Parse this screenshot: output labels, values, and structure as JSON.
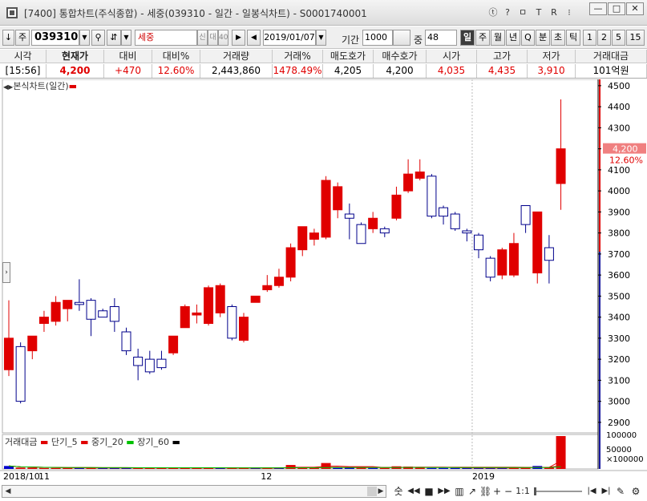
{
  "window": {
    "title": "[7400] 통합차트(주식종합) - 세중(039310 - 일간 - 일봉식차트) - S0001740001",
    "buttons": [
      "ⓣ",
      "?",
      "ㅁ",
      "R",
      "⁝",
      "—",
      "□",
      "✕"
    ]
  },
  "toolbar": {
    "code_arrow": "↓",
    "market": "주",
    "code": "039310",
    "stock_name": "세중",
    "badge_credit": "신",
    "badge_loan": "대",
    "badge_rate": "40",
    "date": "2019/01/07",
    "period_label": "기간",
    "period_value": "1000",
    "count_label": "중",
    "count_value": "48",
    "intervals": [
      "일",
      "주",
      "월",
      "년",
      "Q",
      "분",
      "초",
      "틱",
      "1",
      "2",
      "5",
      "15"
    ],
    "selected_interval": "일"
  },
  "quote": {
    "headers": [
      "시각",
      "현재가",
      "대비",
      "대비%",
      "거래량",
      "거래%",
      "매도호가",
      "매수호가",
      "시가",
      "고가",
      "저가",
      "거래대금"
    ],
    "values": [
      "[15:56]",
      "4,200",
      "+470",
      "12.60%",
      "2,443,860",
      "1478.49%",
      "4,205",
      "4,200",
      "4,035",
      "4,435",
      "3,910",
      "101억원"
    ]
  },
  "legend_price": "본식차트(일간)",
  "legend_volume": {
    "title": "거래대금",
    "items": [
      {
        "name": "단기_5",
        "color": "#e00000"
      },
      {
        "name": "중기_20",
        "color": "#e00000"
      },
      {
        "name": "장기_60",
        "color": "#00c000"
      },
      {
        "name": "",
        "color": "#000000"
      }
    ]
  },
  "chart_data": {
    "type": "candlestick",
    "y_ticks": [
      2900,
      3000,
      3100,
      3200,
      3300,
      3400,
      3500,
      3600,
      3700,
      3800,
      3900,
      4000,
      4100,
      4200,
      4300,
      4400,
      4500
    ],
    "ylim": [
      2850,
      4530
    ],
    "current_price_label": "4,200",
    "current_change_label": "12.60%",
    "current_price": 4200,
    "x_labels": [
      {
        "text": "2018/10",
        "index": 0
      },
      {
        "text": "11",
        "index": 2
      },
      {
        "text": "12",
        "index": 22
      },
      {
        "text": "2019",
        "index": 40
      }
    ],
    "candles": [
      {
        "o": 3150,
        "h": 3480,
        "l": 3120,
        "c": 3300
      },
      {
        "o": 3260,
        "h": 3280,
        "l": 2990,
        "c": 3000
      },
      {
        "o": 3240,
        "h": 3310,
        "l": 3200,
        "c": 3310
      },
      {
        "o": 3370,
        "h": 3430,
        "l": 3330,
        "c": 3400
      },
      {
        "o": 3380,
        "h": 3500,
        "l": 3360,
        "c": 3470
      },
      {
        "o": 3440,
        "h": 3480,
        "l": 3380,
        "c": 3480
      },
      {
        "o": 3470,
        "h": 3580,
        "l": 3430,
        "c": 3460
      },
      {
        "o": 3480,
        "h": 3490,
        "l": 3310,
        "c": 3390
      },
      {
        "o": 3430,
        "h": 3440,
        "l": 3400,
        "c": 3400
      },
      {
        "o": 3450,
        "h": 3490,
        "l": 3330,
        "c": 3380
      },
      {
        "o": 3330,
        "h": 3350,
        "l": 3220,
        "c": 3240
      },
      {
        "o": 3210,
        "h": 3250,
        "l": 3100,
        "c": 3170
      },
      {
        "o": 3200,
        "h": 3240,
        "l": 3130,
        "c": 3140
      },
      {
        "o": 3200,
        "h": 3240,
        "l": 3150,
        "c": 3160
      },
      {
        "o": 3230,
        "h": 3310,
        "l": 3220,
        "c": 3310
      },
      {
        "o": 3350,
        "h": 3460,
        "l": 3350,
        "c": 3450
      },
      {
        "o": 3410,
        "h": 3460,
        "l": 3370,
        "c": 3420
      },
      {
        "o": 3370,
        "h": 3550,
        "l": 3360,
        "c": 3540
      },
      {
        "o": 3420,
        "h": 3560,
        "l": 3400,
        "c": 3550
      },
      {
        "o": 3450,
        "h": 3460,
        "l": 3290,
        "c": 3300
      },
      {
        "o": 3290,
        "h": 3420,
        "l": 3280,
        "c": 3400
      },
      {
        "o": 3470,
        "h": 3500,
        "l": 3470,
        "c": 3500
      },
      {
        "o": 3530,
        "h": 3600,
        "l": 3520,
        "c": 3550
      },
      {
        "o": 3550,
        "h": 3630,
        "l": 3540,
        "c": 3590
      },
      {
        "o": 3590,
        "h": 3750,
        "l": 3570,
        "c": 3730
      },
      {
        "o": 3720,
        "h": 3830,
        "l": 3690,
        "c": 3830
      },
      {
        "o": 3770,
        "h": 3820,
        "l": 3740,
        "c": 3800
      },
      {
        "o": 3780,
        "h": 4070,
        "l": 3770,
        "c": 4050
      },
      {
        "o": 3910,
        "h": 4040,
        "l": 3870,
        "c": 4020
      },
      {
        "o": 3890,
        "h": 3940,
        "l": 3770,
        "c": 3870
      },
      {
        "o": 3840,
        "h": 3850,
        "l": 3750,
        "c": 3750
      },
      {
        "o": 3820,
        "h": 3900,
        "l": 3800,
        "c": 3870
      },
      {
        "o": 3820,
        "h": 3830,
        "l": 3780,
        "c": 3800
      },
      {
        "o": 3870,
        "h": 4020,
        "l": 3860,
        "c": 3980
      },
      {
        "o": 4000,
        "h": 4150,
        "l": 3990,
        "c": 4080
      },
      {
        "o": 4060,
        "h": 4150,
        "l": 4050,
        "c": 4090
      },
      {
        "o": 4070,
        "h": 4080,
        "l": 3870,
        "c": 3880
      },
      {
        "o": 3920,
        "h": 3930,
        "l": 3840,
        "c": 3880
      },
      {
        "o": 3890,
        "h": 3900,
        "l": 3810,
        "c": 3820
      },
      {
        "o": 3810,
        "h": 3820,
        "l": 3760,
        "c": 3800
      },
      {
        "o": 3790,
        "h": 3800,
        "l": 3680,
        "c": 3720
      },
      {
        "o": 3680,
        "h": 3690,
        "l": 3570,
        "c": 3590
      },
      {
        "o": 3600,
        "h": 3730,
        "l": 3580,
        "c": 3720
      },
      {
        "o": 3600,
        "h": 3800,
        "l": 3590,
        "c": 3750
      },
      {
        "o": 3930,
        "h": 3930,
        "l": 3800,
        "c": 3840
      },
      {
        "o": 3610,
        "h": 3900,
        "l": 3560,
        "c": 3900
      },
      {
        "o": 3730,
        "h": 3790,
        "l": 3560,
        "c": 3670
      },
      {
        "o": 4035,
        "h": 4435,
        "l": 3910,
        "c": 4200
      }
    ],
    "volume": {
      "ylabels": [
        "100000",
        "50000",
        "×100000"
      ],
      "values": [
        9,
        4,
        4,
        3,
        3,
        3,
        4,
        3,
        3,
        3,
        3,
        3,
        3,
        3,
        3,
        4,
        3,
        3,
        3,
        3,
        3,
        3,
        3,
        4,
        12,
        4,
        3,
        18,
        5,
        5,
        4,
        3,
        3,
        8,
        7,
        5,
        3,
        3,
        3,
        3,
        3,
        4,
        3,
        3,
        5,
        9,
        4,
        100
      ],
      "up": [
        false,
        true,
        true,
        true,
        true,
        true,
        false,
        true,
        false,
        false,
        false,
        true,
        true,
        true,
        true,
        true,
        true,
        true,
        false,
        true,
        true,
        false,
        true,
        false,
        true,
        true,
        true,
        true,
        false,
        false,
        true,
        false,
        true,
        true,
        true,
        true,
        false,
        false,
        false,
        false,
        false,
        false,
        false,
        true,
        true,
        false,
        true,
        true
      ]
    }
  },
  "navbar": [
    "숫",
    "◀◀",
    "■",
    "▶▶",
    "▥",
    "↗",
    "⛓",
    "+",
    "−",
    "1:1",
    "|◀",
    "▶|",
    "✎",
    "⚙"
  ]
}
